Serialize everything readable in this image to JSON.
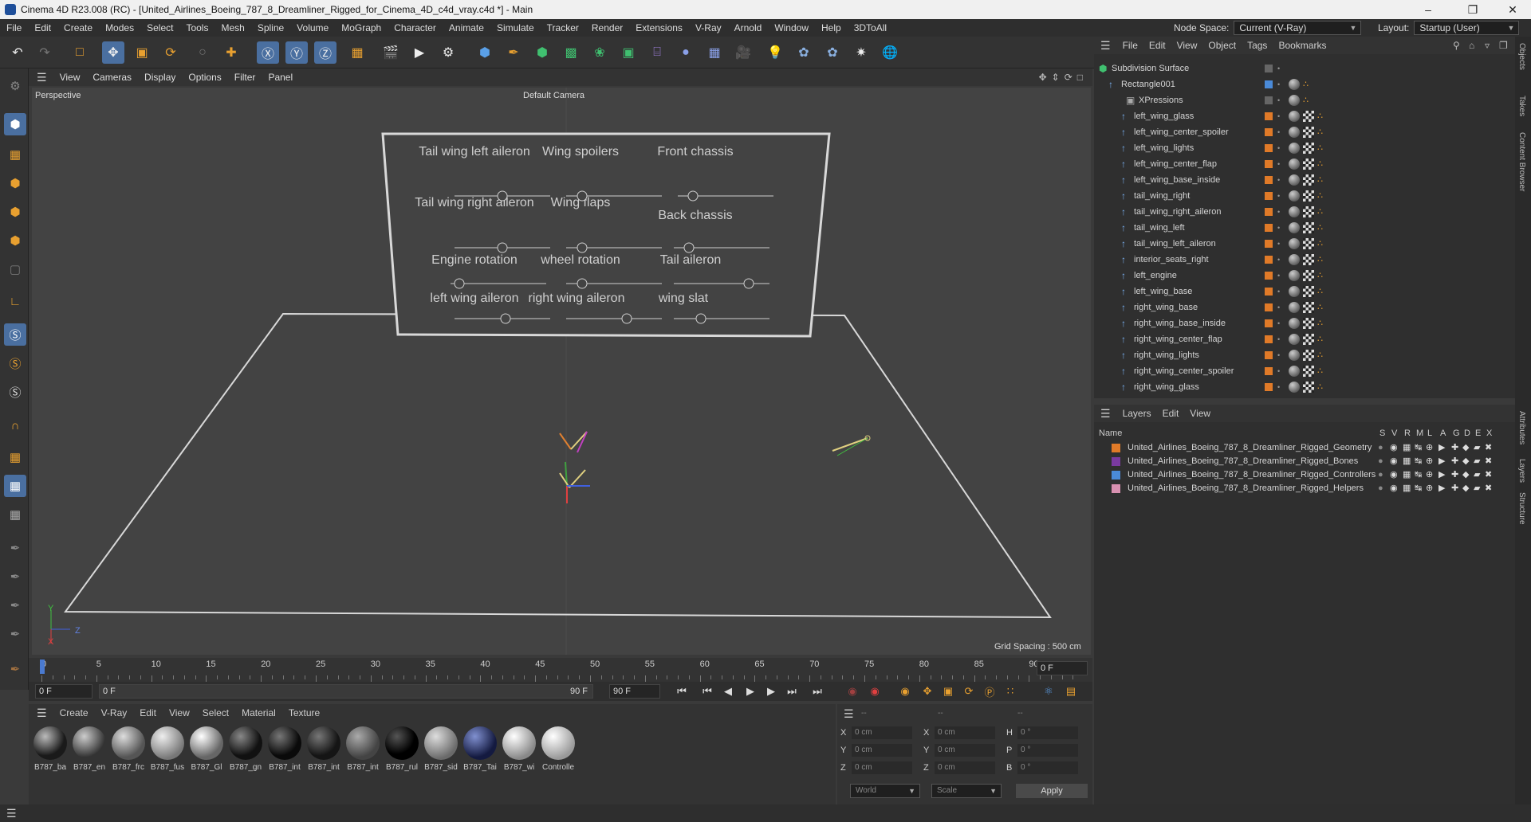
{
  "window": {
    "title": "Cinema 4D R23.008 (RC) - [United_Airlines_Boeing_787_8_Dreamliner_Rigged_for_Cinema_4D_c4d_vray.c4d *] - Main"
  },
  "menubar": {
    "items": [
      "File",
      "Edit",
      "Create",
      "Modes",
      "Select",
      "Tools",
      "Mesh",
      "Spline",
      "Volume",
      "MoGraph",
      "Character",
      "Animate",
      "Simulate",
      "Tracker",
      "Render",
      "Extensions",
      "V-Ray",
      "Arnold",
      "Window",
      "Help",
      "3DToAll"
    ],
    "node_space_label": "Node Space:",
    "node_space_value": "Current (V-Ray)",
    "layout_label": "Layout:",
    "layout_value": "Startup (User)"
  },
  "viewport": {
    "menu": [
      "View",
      "Cameras",
      "Display",
      "Options",
      "Filter",
      "Panel"
    ],
    "view_name": "Perspective",
    "camera": "Default Camera",
    "grid_spacing": "Grid Spacing : 500 cm",
    "axis_z": "Z",
    "axis_y": "Y",
    "axis_x": "X"
  },
  "controllers": [
    "Tail wing left aileron",
    "Wing spoilers",
    "Front chassis",
    "Tail wing right aileron",
    "Wing flaps",
    "Back chassis",
    "Engine rotation",
    "wheel rotation",
    "Tail aileron",
    "left wing aileron",
    "right wing aileron",
    "wing slat"
  ],
  "timeline": {
    "ticks": [
      "0",
      "5",
      "10",
      "15",
      "20",
      "25",
      "30",
      "35",
      "40",
      "45",
      "50",
      "55",
      "60",
      "65",
      "70",
      "75",
      "80",
      "85",
      "90"
    ],
    "current_frame": "0 F"
  },
  "playback": {
    "start": "0 F",
    "range_start": "0 F",
    "range_end": "90 F",
    "end": "90 F"
  },
  "materials": {
    "menu": [
      "Create",
      "V-Ray",
      "Edit",
      "View",
      "Select",
      "Material",
      "Texture"
    ],
    "items": [
      "B787_ba",
      "B787_en",
      "B787_frc",
      "B787_fus",
      "B787_Gl",
      "B787_gn",
      "B787_int",
      "B787_int",
      "B787_int",
      "B787_rul",
      "B787_sid",
      "B787_Tai",
      "B787_wi",
      "Controlle"
    ]
  },
  "coords": {
    "header1": "--",
    "header2": "--",
    "header3": "--",
    "rows": [
      {
        "a": "X",
        "av": "0 cm",
        "b": "X",
        "bv": "0 cm",
        "c": "H",
        "cv": "0 °"
      },
      {
        "a": "Y",
        "av": "0 cm",
        "b": "Y",
        "bv": "0 cm",
        "c": "P",
        "cv": "0 °"
      },
      {
        "a": "Z",
        "av": "0 cm",
        "b": "Z",
        "bv": "0 cm",
        "c": "B",
        "cv": "0 °"
      }
    ],
    "world": "World",
    "scale": "Scale",
    "apply": "Apply"
  },
  "objects": {
    "menu": [
      "File",
      "Edit",
      "View",
      "Object",
      "Tags",
      "Bookmarks"
    ],
    "items": [
      "Subdivision Surface",
      "Rectangle001",
      "XPressions",
      "left_wing_glass",
      "left_wing_center_spoiler",
      "left_wing_lights",
      "left_wing_center_flap",
      "left_wing_base_inside",
      "tail_wing_right",
      "tail_wing_right_aileron",
      "tail_wing_left",
      "tail_wing_left_aileron",
      "interior_seats_right",
      "left_engine",
      "left_wing_base",
      "right_wing_base",
      "right_wing_base_inside",
      "right_wing_center_flap",
      "right_wing_lights",
      "right_wing_center_spoiler",
      "right_wing_glass"
    ]
  },
  "layers": {
    "menu": [
      "Layers",
      "Edit",
      "View"
    ],
    "name_header": "Name",
    "flag_headers": [
      "S",
      "V",
      "R",
      "M",
      "L",
      "A",
      "G",
      "D",
      "E",
      "X"
    ],
    "items": [
      {
        "name": "United_Airlines_Boeing_787_8_Dreamliner_Rigged_Geometry",
        "color": "#e07a28"
      },
      {
        "name": "United_Airlines_Boeing_787_8_Dreamliner_Rigged_Bones",
        "color": "#7a3aa0"
      },
      {
        "name": "United_Airlines_Boeing_787_8_Dreamliner_Rigged_Controllers",
        "color": "#4a8ad8"
      },
      {
        "name": "United_Airlines_Boeing_787_8_Dreamliner_Rigged_Helpers",
        "color": "#d890b0"
      }
    ]
  },
  "sidetabs": [
    "Objects",
    "Takes",
    "Content Browser",
    "Attributes",
    "Layers",
    "Structure"
  ]
}
